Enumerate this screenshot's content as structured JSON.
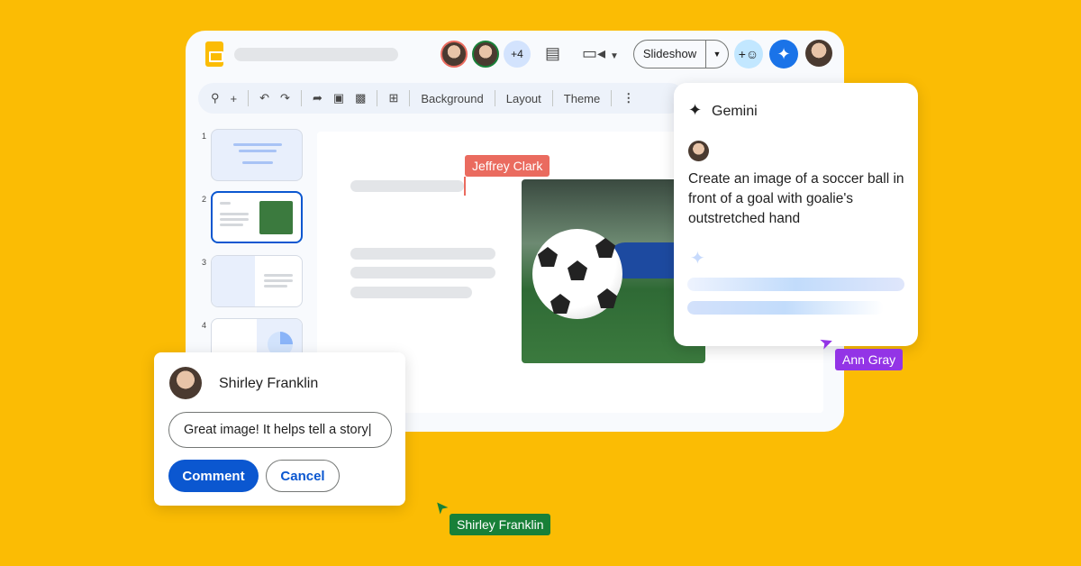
{
  "header": {
    "collaborators_more": "+4",
    "slideshow_label": "Slideshow"
  },
  "toolbar": {
    "background": "Background",
    "layout": "Layout",
    "theme": "Theme"
  },
  "slides": [
    {
      "number": "1"
    },
    {
      "number": "2"
    },
    {
      "number": "3"
    },
    {
      "number": "4"
    }
  ],
  "cursors": {
    "jeffrey": "Jeffrey Clark",
    "ann": "Ann Gray",
    "shirley": "Shirley Franklin"
  },
  "gemini": {
    "title": "Gemini",
    "prompt": "Create an image of a soccer ball in front of a goal with goalie's outstretched hand"
  },
  "comment": {
    "author": "Shirley Franklin",
    "input_value": "Great image! It helps tell a story",
    "comment_button": "Comment",
    "cancel_button": "Cancel"
  },
  "colors": {
    "background": "#FBBC04",
    "accent": "#0b57d0",
    "jeffrey": "#ea6b5f",
    "ann": "#9334e6",
    "shirley": "#188038"
  }
}
